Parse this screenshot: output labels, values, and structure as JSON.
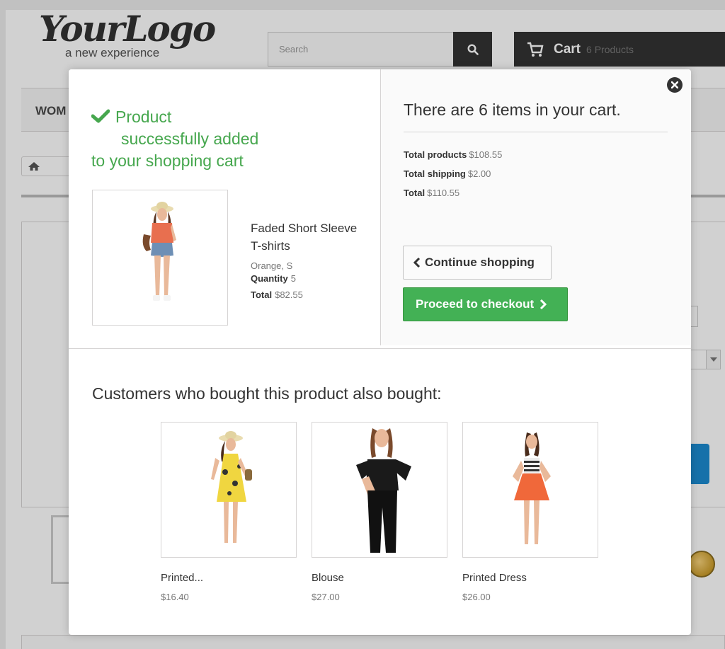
{
  "header": {
    "logo_text": "YourLogo",
    "logo_tagline": "a new experience",
    "search_placeholder": "Search",
    "cart_label": "Cart",
    "cart_count": "6 Products",
    "menu_first_item": "WOM"
  },
  "modal": {
    "added_line1": "Product",
    "added_line2": "successfully added",
    "added_line3": "to your shopping cart",
    "product": {
      "name": "Faded Short Sleeve T-shirts",
      "attributes": "Orange, S",
      "quantity_label": "Quantity",
      "quantity": "5",
      "total_label": "Total",
      "total": "$82.55"
    },
    "cart_heading": "There are 6 items in your cart.",
    "totals": {
      "products_label": "Total products",
      "products_value": "$108.55",
      "shipping_label": "Total shipping",
      "shipping_value": "$2.00",
      "total_label": "Total",
      "total_value": "$110.55"
    },
    "continue_label": "Continue shopping",
    "checkout_label": "Proceed to checkout",
    "also_bought_title": "Customers who bought this product also bought:",
    "recommendations": [
      {
        "name": "Printed...",
        "price": "$16.40"
      },
      {
        "name": "Blouse",
        "price": "$27.00"
      },
      {
        "name": "Printed Dress",
        "price": "$26.00"
      }
    ]
  },
  "colors": {
    "success_green": "#46a74e",
    "checkout_green": "#43b155",
    "dark_bar": "#333333",
    "accent_blue": "#1b8ad0"
  },
  "icons": [
    "search-icon",
    "cart-icon",
    "home-icon",
    "close-icon",
    "check-icon",
    "chevron-left-icon",
    "chevron-right-icon",
    "ssl-badge-icon"
  ]
}
